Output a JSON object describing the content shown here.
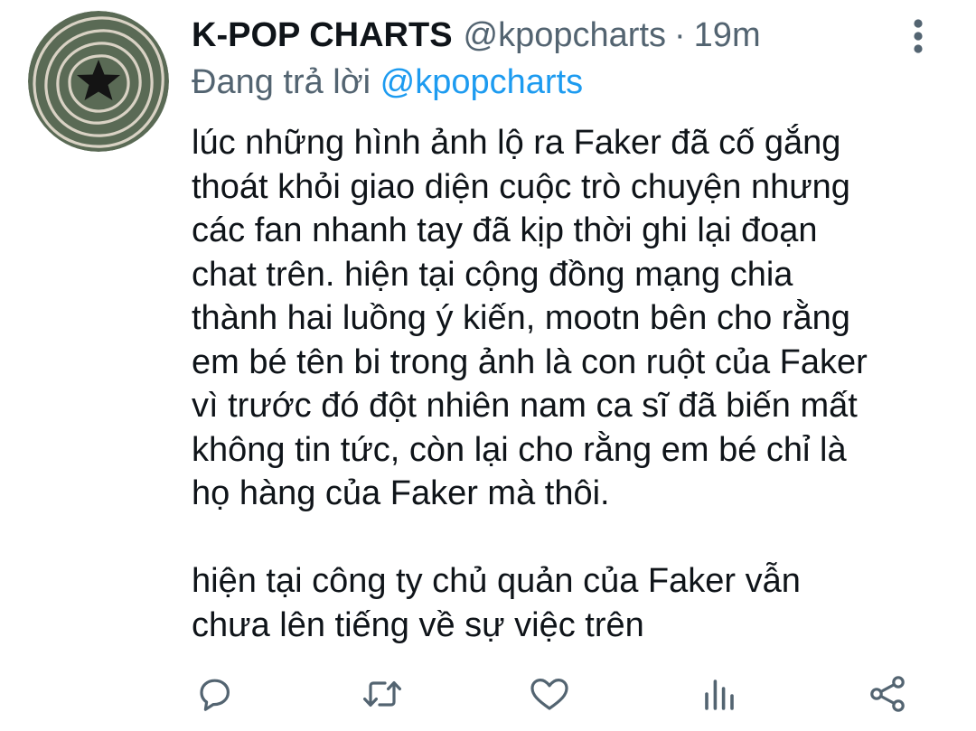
{
  "author": {
    "display_name": "K-POP CHARTS",
    "handle": "@kpopcharts",
    "separator": "·",
    "time": "19m",
    "avatar_icon": "star-ripple-avatar"
  },
  "reply": {
    "prefix": "Đang trả lời ",
    "to_handle": "@kpopcharts"
  },
  "tweet": {
    "lines_p1": [
      "lúc những hình ảnh lộ ra Faker đã cố gắng",
      "thoát khỏi giao diện cuộc trò chuyện nhưng",
      "các fan nhanh tay đã kịp thời ghi lại đoạn",
      "chat trên. hiện tại cộng đồng mạng chia",
      "thành hai luồng ý kiến, mootn bên cho rằng",
      "em bé tên bi trong ảnh là con ruột của Faker",
      "vì trước đó đột nhiên nam ca sĩ đã biến mất",
      "không tin tức, còn lại cho rằng em bé chỉ là",
      "họ hàng của Faker mà thôi."
    ],
    "lines_p2": [
      "hiện tại công ty chủ quản của Faker vẫn",
      "chưa lên tiếng về sự việc trên"
    ]
  },
  "actions": {
    "icons": [
      "reply-icon",
      "retweet-icon",
      "like-icon",
      "analytics-icon",
      "share-icon"
    ],
    "more_icon": "more-vertical-icon"
  },
  "colors": {
    "text": "#0f1419",
    "secondary": "#536471",
    "link": "#1d9bf0",
    "icon": "#536471",
    "avatar_bg": "#5a6a55",
    "avatar_rings": "#d9d2c4"
  }
}
